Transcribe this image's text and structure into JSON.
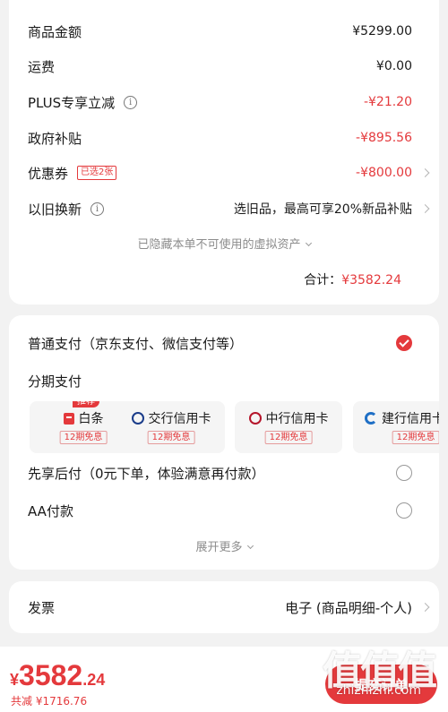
{
  "summary": {
    "goods_amount_label": "商品金额",
    "goods_amount_value": "¥5299.00",
    "shipping_label": "运费",
    "shipping_value": "¥0.00",
    "plus_label": "PLUS专享立减",
    "plus_value": "-¥21.20",
    "subsidy_label": "政府补贴",
    "subsidy_value": "-¥895.56",
    "coupon_label": "优惠券",
    "coupon_tag": "已选2张",
    "coupon_value": "-¥800.00",
    "tradein_label": "以旧换新",
    "tradein_value": "选旧品，最高可享20%新品补贴",
    "hidden_note": "已隐藏本单不可使用的虚拟资产",
    "total_label": "合计：",
    "total_value": "¥3582.24"
  },
  "payment": {
    "normal_label": "普通支付（京东支付、微信支付等）",
    "installment_label": "分期支付",
    "options": [
      {
        "name": "白条",
        "sub": "12期免息",
        "badge": "推荐",
        "icon": "baitiao-icon"
      },
      {
        "name": "交行信用卡",
        "sub": "12期免息",
        "icon": "bocom-icon"
      },
      {
        "name": "中行信用卡",
        "sub": "12期免息",
        "icon": "boc-icon"
      },
      {
        "name": "建行信用卡",
        "sub": "12期免息",
        "icon": "ccb-icon"
      }
    ],
    "paylater_label": "先享后付（0元下单，体验满意再付款）",
    "aa_label": "AA付款",
    "expand_label": "展开更多"
  },
  "invoice": {
    "label": "发票",
    "value": "电子 (商品明细-个人)"
  },
  "footer": {
    "currency": "¥",
    "price_int": "3582",
    "price_dec": ".24",
    "saved": "共减 ¥1716.76",
    "submit": "提交订单",
    "watermark": "值值值",
    "watermark_url": "zhizhizhi.com"
  },
  "colors": {
    "accent": "#e4393c",
    "background": "#f2f2f2"
  }
}
